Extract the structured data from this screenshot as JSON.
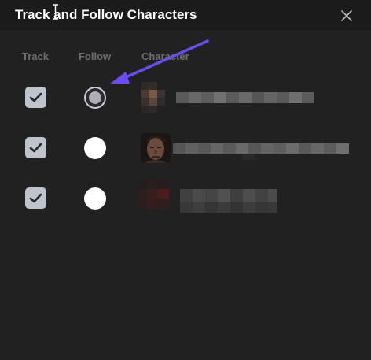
{
  "dialog": {
    "title": "Track and Follow Characters",
    "close_icon": "close-icon"
  },
  "columns": {
    "track": "Track",
    "follow": "Follow",
    "character": "Character"
  },
  "rows": [
    {
      "tracked": true,
      "followed": true
    },
    {
      "tracked": true,
      "followed": false
    },
    {
      "tracked": true,
      "followed": false
    }
  ],
  "colors": {
    "background": "#212121",
    "title_bar": "#1b1b1b",
    "checkbox": "#bfc4cc",
    "radio_selected_dot": "#a9aeb7",
    "annotation_arrow": "#6a4cf0"
  }
}
